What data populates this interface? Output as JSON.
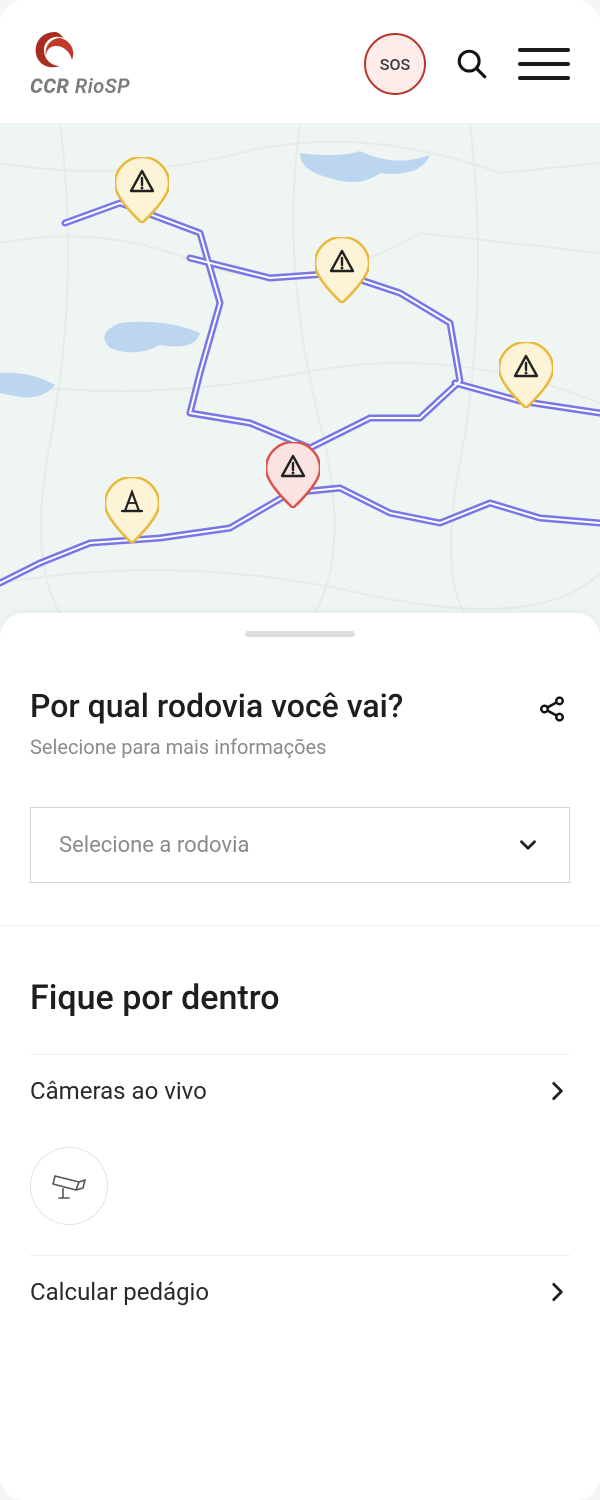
{
  "header": {
    "brand_primary": "CCR",
    "brand_secondary": "RioSP",
    "sos_label": "SOS"
  },
  "panel": {
    "title": "Por qual rodovia você vai?",
    "subtitle": "Selecione para mais informações",
    "select_placeholder": "Selecione a rodovia"
  },
  "section": {
    "title": "Fique por dentro",
    "items": [
      {
        "label": "Câmeras ao vivo"
      },
      {
        "label": "Calcular pedágio"
      }
    ]
  },
  "map": {
    "markers": [
      {
        "type": "warning",
        "severity": "normal"
      },
      {
        "type": "warning",
        "severity": "normal"
      },
      {
        "type": "warning",
        "severity": "normal"
      },
      {
        "type": "warning",
        "severity": "critical"
      },
      {
        "type": "cone",
        "severity": "normal"
      }
    ]
  },
  "colors": {
    "accent_red": "#b8352e",
    "marker_yellow_fill": "#fdf3d6",
    "marker_yellow_stroke": "#e8b93b",
    "marker_red_fill": "#fbe3e1",
    "marker_red_stroke": "#d9534f",
    "route": "#7b76e8"
  }
}
